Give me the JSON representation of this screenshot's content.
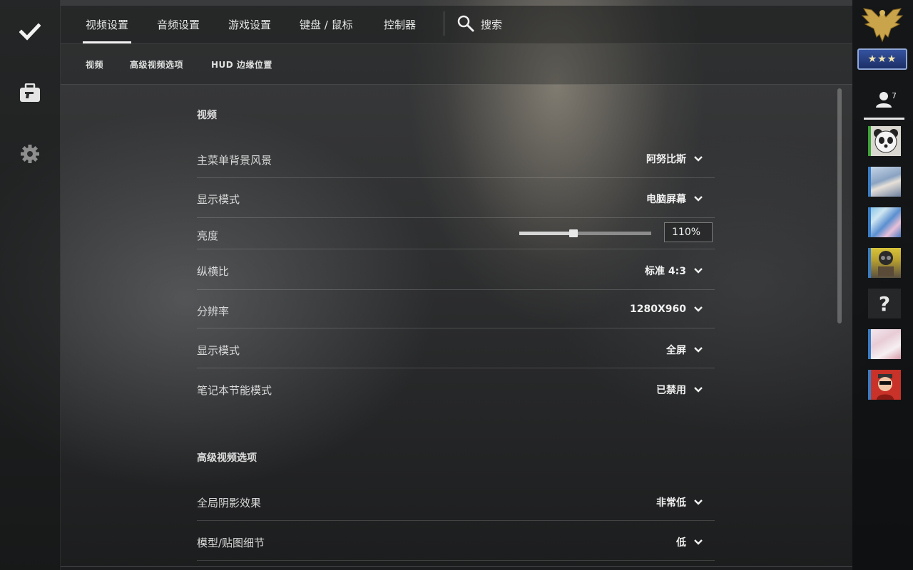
{
  "left_rail": {
    "icons": [
      "checkmark-icon",
      "briefcase-icon",
      "gear-icon"
    ]
  },
  "top_nav": {
    "tabs": [
      {
        "label": "视频设置",
        "active": true
      },
      {
        "label": "音频设置",
        "active": false
      },
      {
        "label": "游戏设置",
        "active": false
      },
      {
        "label": "键盘 / 鼠标",
        "active": false
      },
      {
        "label": "控制器",
        "active": false
      }
    ],
    "search_label": "搜索"
  },
  "sub_nav": {
    "tabs": [
      "视频",
      "高级视频选项",
      "HUD 边缘位置"
    ]
  },
  "sections": [
    {
      "title": "视频",
      "rows": [
        {
          "label": "主菜单背景风景",
          "value": "阿努比斯"
        },
        {
          "label": "显示模式",
          "value": "电脑屏幕"
        },
        {
          "label": "亮度",
          "slider_value": "110%",
          "slider_fraction": 0.41
        },
        {
          "label": "纵横比",
          "value": "标准 4:3"
        },
        {
          "label": "分辨率",
          "value": "1280X960"
        },
        {
          "label": "显示模式",
          "value": "全屏"
        },
        {
          "label": "笔记本节能模式",
          "value": "已禁用"
        }
      ]
    },
    {
      "title": "高级视频选项",
      "rows": [
        {
          "label": "全局阴影效果",
          "value": "非常低"
        },
        {
          "label": "模型/贴图细节",
          "value": "低"
        }
      ]
    }
  ],
  "right_panel": {
    "rank_stars": "★★★",
    "friends_count": "7",
    "avatars": [
      {
        "name": "panda",
        "stripe": "#3fa33a",
        "bg": "#d9d7d0"
      },
      {
        "name": "anime-girl-1",
        "stripe": "#3a7cc4",
        "bg": "#9fb6d0"
      },
      {
        "name": "colorful-art",
        "stripe": "#3a7cc4",
        "bg": "#6fa7d6"
      },
      {
        "name": "soldier",
        "stripe": "#3a7cc4",
        "bg": "#c8b43a"
      },
      {
        "name": "unknown",
        "label": "?"
      },
      {
        "name": "anime-girl-2",
        "stripe": "#3a7cc4",
        "bg": "#e8d6dc"
      },
      {
        "name": "red-character",
        "stripe": "#3a7cc4",
        "bg": "#c83228"
      }
    ]
  }
}
